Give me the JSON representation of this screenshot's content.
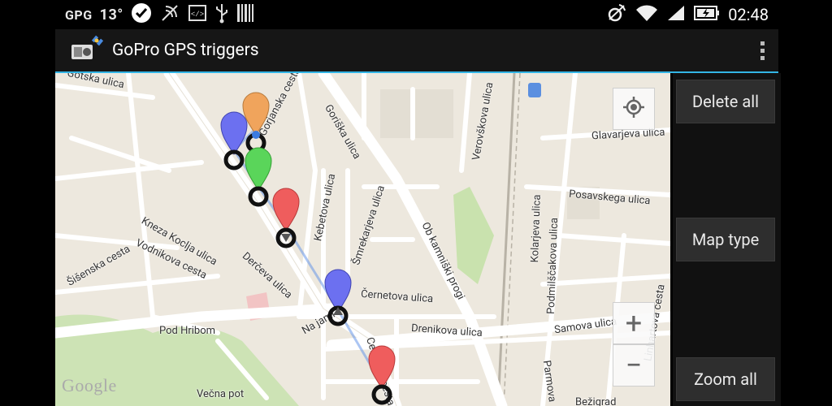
{
  "status_bar": {
    "carrier": "GPG",
    "temperature": "13°",
    "time": "02:48",
    "icons": [
      "check-icon",
      "nfc-icon",
      "code-icon",
      "usb-icon",
      "barcode-icon",
      "vibrate-icon",
      "wifi-icon",
      "signal-icon",
      "battery-charging-icon"
    ]
  },
  "action_bar": {
    "title": "GoPro GPS triggers",
    "app_icon": "gopro-satellite-icon",
    "overflow_icon": "overflow-menu-icon"
  },
  "side_panel": {
    "delete_all": "Delete all",
    "map_type": "Map type",
    "zoom_all": "Zoom all"
  },
  "map": {
    "watermark": "Google",
    "controls": {
      "my_location_icon": "crosshair-icon",
      "zoom_in": "+",
      "zoom_out": "−"
    },
    "streets": [
      "Gotska ulica",
      "Gorjanska cesta",
      "Goriška ulica",
      "Verovškova ulica",
      "Glavarjeva ulica",
      "Kebetova ulica",
      "Šmrekarjeva ulica",
      "Ob kamniški progi",
      "Posavskega ulica",
      "Kolarjeva ulica",
      "Podmilščakova ulica",
      "Kneza Koclja ulica",
      "Vodnikova cesta",
      "Šišenska cesta",
      "Derčeva ulica",
      "Černetova ulica",
      "Drenikova ulica",
      "Samova ulica",
      "Na jami",
      "Celovška cesta",
      "Pod Hribom",
      "Večna pot",
      "Parmova",
      "Bežigrad",
      "Linhartova cesta"
    ],
    "markers": [
      {
        "color": "#f0a45c",
        "type": "orange"
      },
      {
        "color": "#6c70f0",
        "type": "blue"
      },
      {
        "color": "#5ad55a",
        "type": "green"
      },
      {
        "color": "#ef5d5d",
        "type": "red"
      },
      {
        "color": "#6c70f0",
        "type": "blue"
      },
      {
        "color": "#ef5d5d",
        "type": "red"
      }
    ]
  }
}
